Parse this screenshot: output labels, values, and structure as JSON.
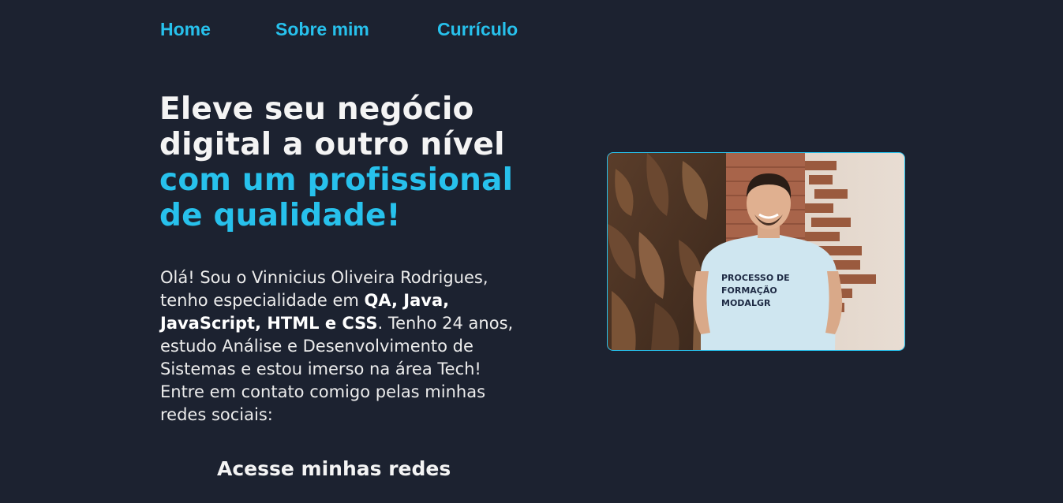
{
  "nav": {
    "items": [
      {
        "label": "Home"
      },
      {
        "label": "Sobre mim"
      },
      {
        "label": "Currículo"
      }
    ],
    "color": "#27c1ec"
  },
  "hero": {
    "line1": "Eleve seu negócio",
    "line2": "digital a outro nível",
    "line3": "com um profissional",
    "line4": "de qualidade!"
  },
  "intro": {
    "l1": "Olá! Sou o Vinnicius Oliveira Rodrigues,",
    "l2_a": "tenho especialidade em ",
    "l2_b": "QA, Java,",
    "l3_a": "JavaScript, HTML e CSS",
    "l3_b": ". Tenho 24 anos,",
    "l4": "estudo Análise e Desenvolvimento de",
    "l5": "Sistemas e estou imerso na área Tech!",
    "l6": "Entre em contato comigo pelas minhas",
    "l7": "redes sociais:"
  },
  "social": {
    "title": "Acesse minhas redes"
  },
  "photo": {
    "shirt_line1": "PROCESSO DE",
    "shirt_line2": "FORMAÇÃO",
    "shirt_line3": "MODALGR"
  },
  "colors": {
    "background": "#1c2230",
    "accent": "#27c1ec",
    "text": "#f4f4f4"
  }
}
